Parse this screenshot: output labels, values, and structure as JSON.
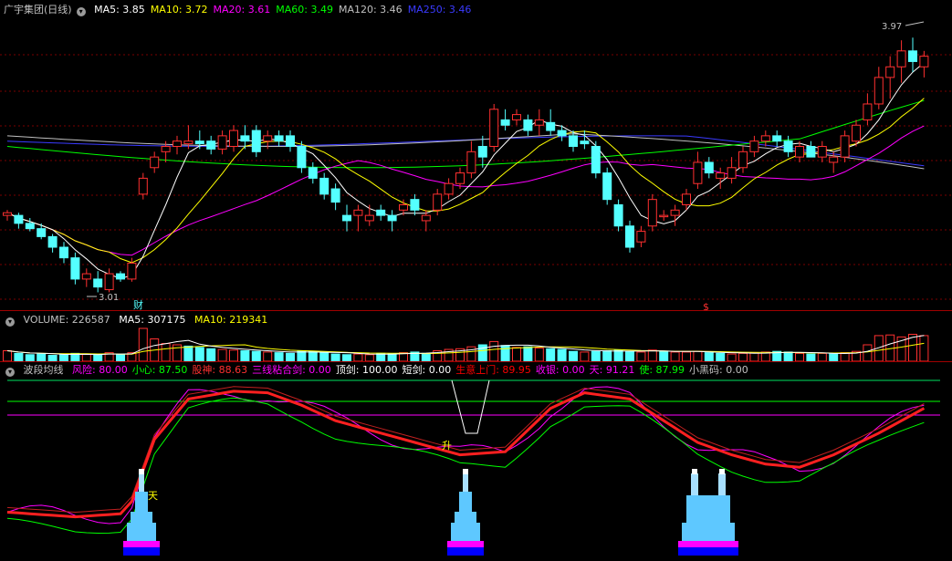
{
  "price_panel": {
    "title": "广宇集团(日线)",
    "ma": [
      {
        "label": "MA5: 3.85",
        "color": "#ffffff"
      },
      {
        "label": "MA10: 3.72",
        "color": "#ffff00"
      },
      {
        "label": "MA20: 3.61",
        "color": "#ff00ff"
      },
      {
        "label": "MA60: 3.49",
        "color": "#00ff00"
      },
      {
        "label": "MA120: 3.46",
        "color": "#c0c0c0"
      },
      {
        "label": "MA250: 3.46",
        "color": "#3a3aff"
      }
    ],
    "high_label": "3.97",
    "low_label": "3.01",
    "marker_cai": "财",
    "marker_dollar": "$"
  },
  "volume_panel": {
    "title": "VOLUME: 226587",
    "ma5": "MA5: 307175",
    "ma10": "MA10: 219341"
  },
  "indicator_panel": {
    "title": "波段均线",
    "items": [
      {
        "label": "风险: 80.00",
        "color": "#ff00ff"
      },
      {
        "label": "小心: 87.50",
        "color": "#00ff00"
      },
      {
        "label": "股神: 88.63",
        "color": "#ff3030"
      },
      {
        "label": "三线粘合剑: 0.00",
        "color": "#ff00ff"
      },
      {
        "label": "顶剑: 100.00",
        "color": "#ffffff"
      },
      {
        "label": "短剑: 0.00",
        "color": "#ffffff"
      },
      {
        "label": "生意上门: 89.95",
        "color": "#ff0000"
      },
      {
        "label": "收银: 0.00",
        "color": "#ff00ff"
      },
      {
        "label": "天: 91.21",
        "color": "#ff00ff"
      },
      {
        "label": "使: 87.99",
        "color": "#00ff00"
      },
      {
        "label": "小黑码: 0.00",
        "color": "#c0c0c0"
      }
    ],
    "signal_sheng": "升",
    "signal_tian": "天"
  },
  "chart_data": {
    "type": "candlestick",
    "title": "广宇集团(日线)",
    "high_marker": 3.97,
    "low_marker": 3.01,
    "candles": [
      [
        3.3,
        3.32,
        3.28,
        3.31
      ],
      [
        3.3,
        3.31,
        3.25,
        3.27
      ],
      [
        3.27,
        3.29,
        3.24,
        3.25
      ],
      [
        3.25,
        3.27,
        3.21,
        3.22
      ],
      [
        3.22,
        3.23,
        3.16,
        3.18
      ],
      [
        3.18,
        3.2,
        3.12,
        3.14
      ],
      [
        3.14,
        3.16,
        3.04,
        3.06
      ],
      [
        3.06,
        3.1,
        3.03,
        3.08
      ],
      [
        3.06,
        3.09,
        3.01,
        3.03
      ],
      [
        3.02,
        3.1,
        3.01,
        3.08
      ],
      [
        3.08,
        3.09,
        3.05,
        3.06
      ],
      [
        3.06,
        3.14,
        3.05,
        3.12
      ],
      [
        3.38,
        3.46,
        3.36,
        3.44
      ],
      [
        3.48,
        3.54,
        3.46,
        3.52
      ],
      [
        3.54,
        3.58,
        3.5,
        3.56
      ],
      [
        3.56,
        3.6,
        3.53,
        3.58
      ],
      [
        3.57,
        3.64,
        3.55,
        3.58
      ],
      [
        3.58,
        3.62,
        3.55,
        3.57
      ],
      [
        3.58,
        3.6,
        3.53,
        3.55
      ],
      [
        3.55,
        3.62,
        3.53,
        3.6
      ],
      [
        3.56,
        3.64,
        3.54,
        3.62
      ],
      [
        3.6,
        3.64,
        3.55,
        3.58
      ],
      [
        3.62,
        3.64,
        3.52,
        3.54
      ],
      [
        3.58,
        3.62,
        3.55,
        3.6
      ],
      [
        3.6,
        3.62,
        3.56,
        3.58
      ],
      [
        3.6,
        3.62,
        3.54,
        3.56
      ],
      [
        3.56,
        3.58,
        3.46,
        3.48
      ],
      [
        3.48,
        3.5,
        3.42,
        3.44
      ],
      [
        3.44,
        3.46,
        3.36,
        3.38
      ],
      [
        3.4,
        3.42,
        3.32,
        3.35
      ],
      [
        3.3,
        3.34,
        3.24,
        3.28
      ],
      [
        3.3,
        3.34,
        3.24,
        3.32
      ],
      [
        3.28,
        3.34,
        3.26,
        3.3
      ],
      [
        3.32,
        3.34,
        3.28,
        3.3
      ],
      [
        3.3,
        3.32,
        3.24,
        3.28
      ],
      [
        3.32,
        3.36,
        3.3,
        3.34
      ],
      [
        3.36,
        3.38,
        3.3,
        3.32
      ],
      [
        3.28,
        3.32,
        3.24,
        3.3
      ],
      [
        3.32,
        3.4,
        3.3,
        3.38
      ],
      [
        3.38,
        3.44,
        3.36,
        3.42
      ],
      [
        3.42,
        3.48,
        3.4,
        3.46
      ],
      [
        3.46,
        3.58,
        3.44,
        3.54
      ],
      [
        3.56,
        3.6,
        3.48,
        3.52
      ],
      [
        3.56,
        3.72,
        3.54,
        3.7
      ],
      [
        3.66,
        3.7,
        3.62,
        3.64
      ],
      [
        3.66,
        3.7,
        3.64,
        3.68
      ],
      [
        3.66,
        3.68,
        3.6,
        3.62
      ],
      [
        3.64,
        3.7,
        3.6,
        3.66
      ],
      [
        3.65,
        3.7,
        3.6,
        3.62
      ],
      [
        3.62,
        3.64,
        3.58,
        3.6
      ],
      [
        3.6,
        3.62,
        3.54,
        3.56
      ],
      [
        3.58,
        3.62,
        3.55,
        3.57
      ],
      [
        3.56,
        3.58,
        3.44,
        3.46
      ],
      [
        3.46,
        3.48,
        3.34,
        3.36
      ],
      [
        3.34,
        3.36,
        3.24,
        3.26
      ],
      [
        3.26,
        3.28,
        3.16,
        3.18
      ],
      [
        3.2,
        3.26,
        3.18,
        3.24
      ],
      [
        3.26,
        3.38,
        3.24,
        3.36
      ],
      [
        3.3,
        3.32,
        3.28,
        3.3
      ],
      [
        3.3,
        3.34,
        3.26,
        3.32
      ],
      [
        3.34,
        3.4,
        3.32,
        3.38
      ],
      [
        3.42,
        3.54,
        3.4,
        3.5
      ],
      [
        3.5,
        3.52,
        3.44,
        3.46
      ],
      [
        3.44,
        3.48,
        3.4,
        3.46
      ],
      [
        3.44,
        3.52,
        3.42,
        3.48
      ],
      [
        3.48,
        3.56,
        3.46,
        3.54
      ],
      [
        3.54,
        3.6,
        3.52,
        3.58
      ],
      [
        3.58,
        3.62,
        3.56,
        3.6
      ],
      [
        3.6,
        3.62,
        3.56,
        3.58
      ],
      [
        3.58,
        3.6,
        3.52,
        3.54
      ],
      [
        3.52,
        3.58,
        3.5,
        3.56
      ],
      [
        3.56,
        3.58,
        3.52,
        3.52
      ],
      [
        3.52,
        3.58,
        3.5,
        3.56
      ],
      [
        3.5,
        3.54,
        3.46,
        3.52
      ],
      [
        3.52,
        3.62,
        3.5,
        3.6
      ],
      [
        3.58,
        3.66,
        3.56,
        3.64
      ],
      [
        3.66,
        3.76,
        3.64,
        3.72
      ],
      [
        3.72,
        3.86,
        3.7,
        3.82
      ],
      [
        3.82,
        3.9,
        3.74,
        3.86
      ],
      [
        3.86,
        3.96,
        3.8,
        3.92
      ],
      [
        3.92,
        3.97,
        3.84,
        3.88
      ],
      [
        3.86,
        3.92,
        3.82,
        3.9
      ]
    ],
    "volume": [
      32,
      24,
      20,
      22,
      18,
      20,
      24,
      22,
      18,
      26,
      20,
      26,
      100,
      68,
      54,
      50,
      46,
      42,
      38,
      36,
      34,
      32,
      30,
      28,
      26,
      24,
      32,
      30,
      26,
      22,
      20,
      22,
      20,
      24,
      22,
      26,
      28,
      24,
      32,
      36,
      38,
      44,
      50,
      60,
      48,
      42,
      44,
      40,
      38,
      36,
      30,
      28,
      30,
      32,
      34,
      30,
      28,
      34,
      30,
      28,
      28,
      30,
      26,
      24,
      22,
      24,
      26,
      28,
      30,
      28,
      24,
      22,
      24,
      22,
      26,
      30,
      50,
      78,
      80,
      74,
      82,
      78
    ],
    "volume_color": [
      "r",
      "c",
      "c",
      "c",
      "c",
      "c",
      "c",
      "r",
      "c",
      "r",
      "c",
      "r",
      "r",
      "r",
      "r",
      "r",
      "c",
      "c",
      "c",
      "r",
      "r",
      "c",
      "c",
      "r",
      "c",
      "c",
      "c",
      "c",
      "c",
      "c",
      "c",
      "r",
      "r",
      "c",
      "c",
      "r",
      "c",
      "c",
      "r",
      "r",
      "r",
      "r",
      "c",
      "r",
      "c",
      "r",
      "c",
      "r",
      "c",
      "c",
      "c",
      "r",
      "c",
      "c",
      "c",
      "c",
      "r",
      "r",
      "c",
      "r",
      "r",
      "r",
      "c",
      "c",
      "r",
      "r",
      "r",
      "r",
      "c",
      "c",
      "r",
      "c",
      "r",
      "c",
      "r",
      "r",
      "r",
      "r",
      "r",
      "r",
      "r",
      "r"
    ],
    "grid": true
  }
}
